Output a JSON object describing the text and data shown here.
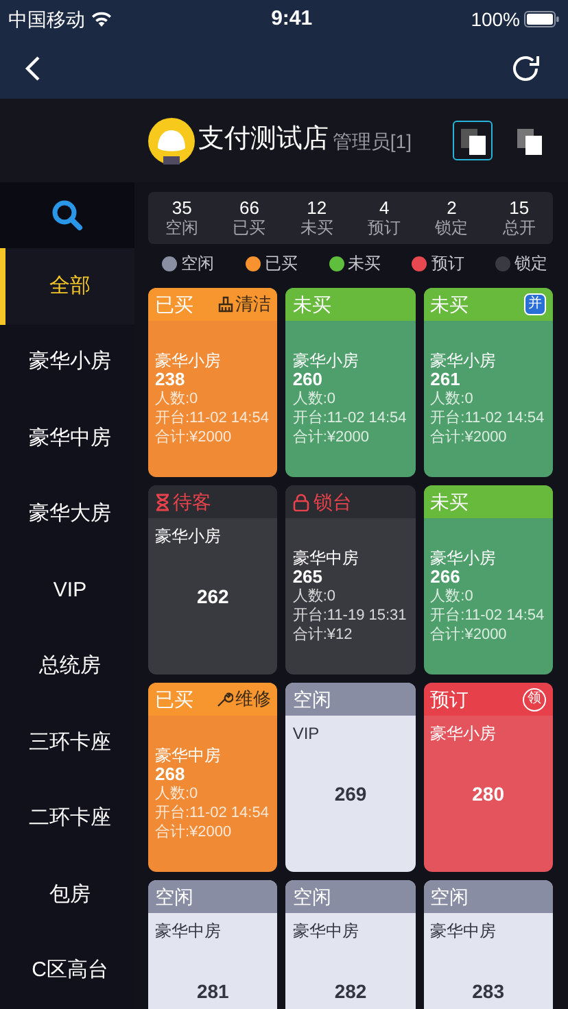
{
  "status_bar": {
    "carrier": "中国移动",
    "time": "9:41",
    "battery": "100%"
  },
  "header": {
    "store_name": "支付测试店",
    "role": "管理员[1]",
    "view_toggles": [
      {
        "selected": true
      },
      {
        "selected": false
      }
    ]
  },
  "sidebar": {
    "items": [
      {
        "label": "全部",
        "selected": true
      },
      {
        "label": "豪华小房",
        "selected": false
      },
      {
        "label": "豪华中房",
        "selected": false
      },
      {
        "label": "豪华大房",
        "selected": false
      },
      {
        "label": "VIP",
        "selected": false
      },
      {
        "label": "总统房",
        "selected": false
      },
      {
        "label": "三环卡座",
        "selected": false
      },
      {
        "label": "二环卡座",
        "selected": false
      },
      {
        "label": "包房",
        "selected": false
      },
      {
        "label": "C区高台",
        "selected": false
      }
    ]
  },
  "stats": [
    {
      "count": "35",
      "label": "空闲"
    },
    {
      "count": "66",
      "label": "已买"
    },
    {
      "count": "12",
      "label": "未买"
    },
    {
      "count": "4",
      "label": "预订"
    },
    {
      "count": "2",
      "label": "锁定"
    },
    {
      "count": "15",
      "label": "总开"
    }
  ],
  "legend": [
    {
      "label": "空闲",
      "color": "#8a8fa3"
    },
    {
      "label": "已买",
      "color": "#f7922f"
    },
    {
      "label": "未买",
      "color": "#5fbf3c"
    },
    {
      "label": "预订",
      "color": "#e84850"
    },
    {
      "label": "锁定",
      "color": "#3a3b40"
    }
  ],
  "rooms": [
    {
      "kind": "sold",
      "label": "已买",
      "tag": {
        "kind": "broom",
        "text": "清洁"
      },
      "room_type": "豪华小房",
      "room_no": "238",
      "details": [
        "人数:0",
        "开台:11-02 14:54",
        "合计:¥2000"
      ]
    },
    {
      "kind": "unsold",
      "label": "未买",
      "room_type": "豪华小房",
      "room_no": "260",
      "details": [
        "人数:0",
        "开台:11-02 14:54",
        "合计:¥2000"
      ]
    },
    {
      "kind": "unsold",
      "label": "未买",
      "tag": {
        "kind": "badge",
        "text": "并"
      },
      "room_type": "豪华小房",
      "room_no": "261",
      "details": [
        "人数:0",
        "开台:11-02 14:54",
        "合计:¥2000"
      ]
    },
    {
      "kind": "waiting",
      "label": "待客",
      "room_type": "豪华小房",
      "room_no": "262"
    },
    {
      "kind": "locked",
      "label": "锁台",
      "room_type": "豪华中房",
      "room_no": "265",
      "details": [
        "人数:0",
        "开台:11-19 15:31",
        "合计:¥12"
      ]
    },
    {
      "kind": "unsold",
      "label": "未买",
      "room_type": "豪华小房",
      "room_no": "266",
      "details": [
        "人数:0",
        "开台:11-02 14:54",
        "合计:¥2000"
      ]
    },
    {
      "kind": "sold",
      "label": "已买",
      "tag": {
        "kind": "wrench",
        "text": "维修"
      },
      "room_type": "豪华中房",
      "room_no": "268",
      "details": [
        "人数:0",
        "开台:11-02 14:54",
        "合计:¥2000"
      ]
    },
    {
      "kind": "free",
      "label": "空闲",
      "room_type": "VIP",
      "room_no": "269"
    },
    {
      "kind": "reserved",
      "label": "预订",
      "tag": {
        "kind": "circle",
        "text": "领"
      },
      "room_type": "豪华小房",
      "room_no": "280"
    },
    {
      "kind": "free",
      "label": "空闲",
      "room_type": "豪华中房",
      "room_no": "281"
    },
    {
      "kind": "free",
      "label": "空闲",
      "room_type": "豪华中房",
      "room_no": "282"
    },
    {
      "kind": "free",
      "label": "空闲",
      "room_type": "豪华中房",
      "room_no": "283"
    }
  ]
}
